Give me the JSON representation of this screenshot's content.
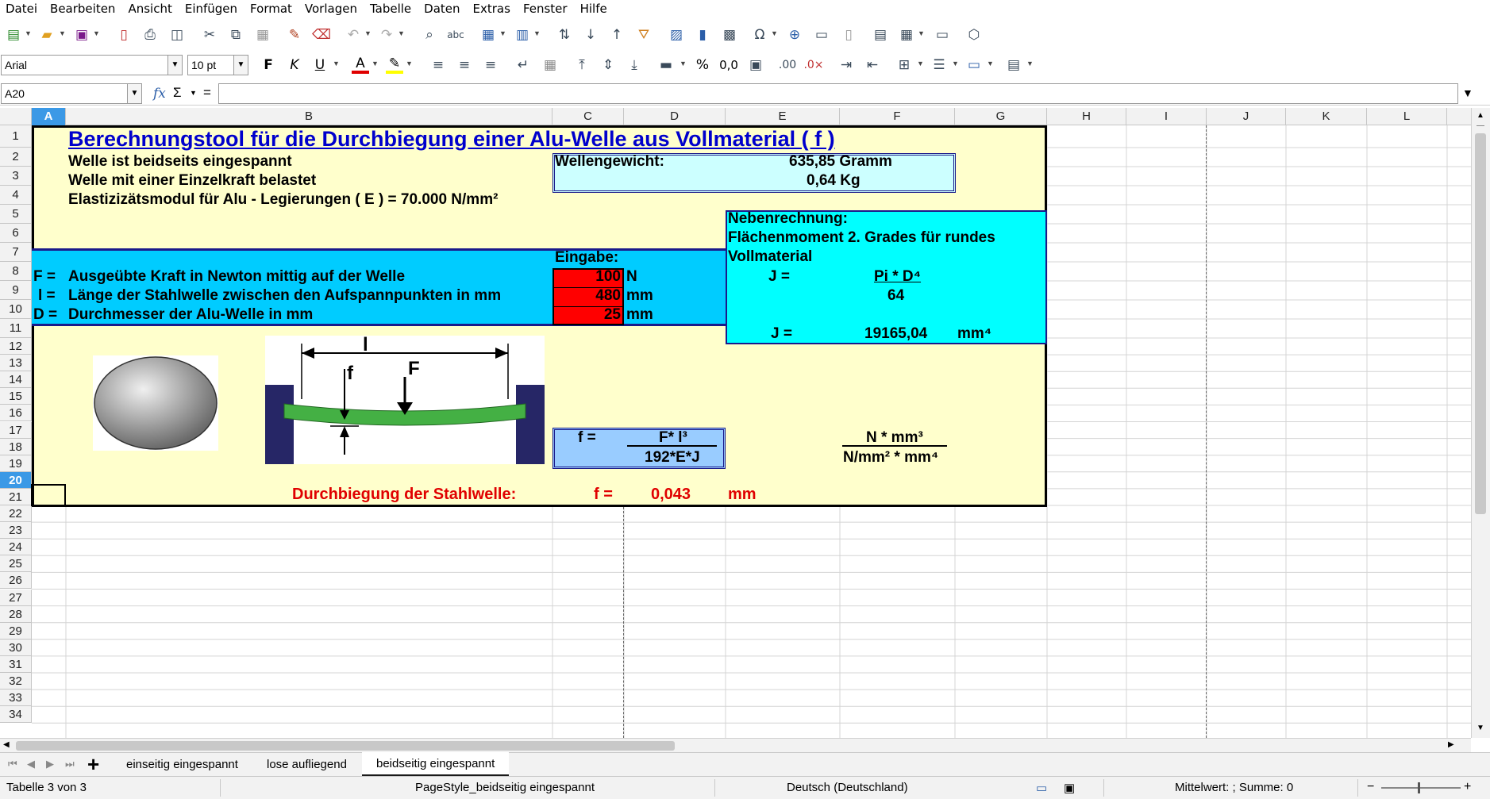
{
  "menubar": {
    "items": [
      "Datei",
      "Bearbeiten",
      "Ansicht",
      "Einfügen",
      "Format",
      "Vorlagen",
      "Tabelle",
      "Daten",
      "Extras",
      "Fenster",
      "Hilfe"
    ]
  },
  "format_toolbar": {
    "font_name": "Arial",
    "font_size": "10 pt",
    "bold_label": "F",
    "italic_label": "K",
    "underline_label": "U",
    "percent_label": "%",
    "decimal_label": "0,0"
  },
  "formula_bar": {
    "name_box": "A20",
    "fx": "fx",
    "sigma": "Σ",
    "equals": "=",
    "content": ""
  },
  "columns": [
    "A",
    "B",
    "C",
    "D",
    "E",
    "F",
    "G",
    "H",
    "I",
    "J",
    "K",
    "L"
  ],
  "rows": [
    "1",
    "2",
    "3",
    "4",
    "5",
    "6",
    "7",
    "8",
    "9",
    "10",
    "11",
    "12",
    "13",
    "14",
    "15",
    "16",
    "17",
    "18",
    "19",
    "20",
    "21",
    "22",
    "23",
    "24",
    "25",
    "26",
    "27",
    "28",
    "29",
    "30",
    "31",
    "32",
    "33",
    "34"
  ],
  "sheet": {
    "title": "Berechnungstool für die Durchbiegung einer Alu-Welle aus Vollmaterial ( f )",
    "line2": "Welle ist beidseits eingespannt",
    "line3": "Welle mit einer Einzelkraft belastet",
    "line4": "Elastizizätsmodul für Alu - Legierungen ( E ) = 70.000 N/mm²",
    "weight_label": "Wellengewicht:",
    "weight_gram": "635,85 Gramm",
    "weight_kg": "0,64 Kg",
    "side_title1": "Nebenrechnung:",
    "side_title2": "Flächenmoment 2. Grades für rundes",
    "side_title3": "Vollmaterial",
    "j_label": "J =",
    "j_numerator": "Pi * D⁴",
    "j_denominator": "64",
    "j_result_label": "J =",
    "j_result_value": "19165,04",
    "j_result_unit": "mm⁴",
    "input_label": "Eingabe:",
    "f_sym": "F =",
    "f_desc": "Ausgeübte Kraft in Newton mittig auf der Welle",
    "f_value": "100",
    "f_unit": "N",
    "l_sym": "l =",
    "l_desc": "Länge der Stahlwelle zwischen den Aufspannpunkten in mm",
    "l_value": "480",
    "l_unit": "mm",
    "d_sym": "D =",
    "d_desc": "Durchmesser der Alu-Welle in mm",
    "d_value": "25",
    "d_unit": "mm",
    "formula_f": "f =",
    "formula_num": "F* l³",
    "formula_den": "192*E*J",
    "units_num": "N * mm³",
    "units_den": "N/mm² * mm⁴",
    "result_label": "Durchbiegung der Stahlwelle:",
    "result_sym": "f =",
    "result_value": "0,043",
    "result_unit": "mm",
    "diagram_l": "l",
    "diagram_f_small": "f",
    "diagram_F": "F"
  },
  "tabs": {
    "items": [
      "einseitig eingespannt",
      "lose aufliegend",
      "beidseitig eingespannt"
    ],
    "active": "beidseitig eingespannt"
  },
  "statusbar": {
    "sheet_info": "Tabelle 3 von 3",
    "page_style": "PageStyle_beidseitig eingespannt",
    "language": "Deutsch (Deutschland)",
    "summary": "Mittelwert: ; Summe: 0",
    "zoom_minus": "−",
    "zoom_plus": "+"
  },
  "colors": {
    "pale_yellow": "#ffffcc",
    "cyan_block": "#00ccff",
    "side_cyan": "#00ffff",
    "light_cyan": "#ccffff",
    "light_blue": "#99ccff",
    "input_red": "#ff0000",
    "title_blue": "#0000cc"
  }
}
